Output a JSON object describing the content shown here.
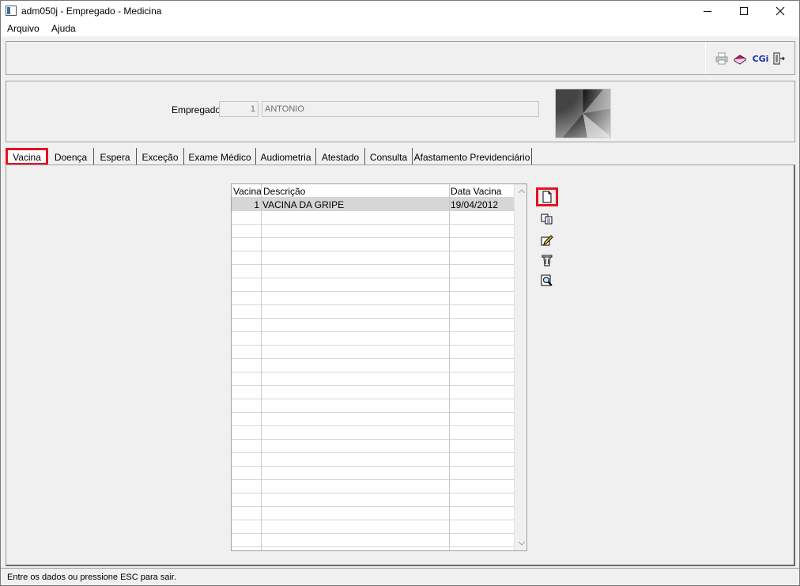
{
  "window": {
    "title": "adm050j - Empregado - Medicina",
    "minimize_glyph": "—",
    "maximize_glyph": "☐",
    "close_glyph": "✕"
  },
  "menu": {
    "items": [
      "Arquivo",
      "Ajuda"
    ]
  },
  "toolbar": {
    "icons": [
      "printer-icon",
      "book-icon",
      "cgi-icon",
      "exit-door-icon"
    ],
    "cgi_label": "CGi"
  },
  "employee": {
    "label": "Empregado:",
    "code": "1",
    "name": "ANTONIO"
  },
  "tabs": [
    {
      "label": "Vacina",
      "active": true
    },
    {
      "label": "Doença",
      "active": false
    },
    {
      "label": "Espera",
      "active": false
    },
    {
      "label": "Exceção",
      "active": false
    },
    {
      "label": "Exame Médico",
      "active": false
    },
    {
      "label": "Audiometria",
      "active": false
    },
    {
      "label": "Atestado",
      "active": false
    },
    {
      "label": "Consulta",
      "active": false
    },
    {
      "label": "Afastamento Previdenciário",
      "active": false
    }
  ],
  "grid": {
    "columns": [
      "Vacina",
      "Descrição",
      "Data Vacina"
    ],
    "rows": [
      {
        "vacina": "1",
        "descricao": "VACINA DA GRIPE",
        "data": "19/04/2012"
      }
    ]
  },
  "actions": [
    "new-document-icon",
    "copy-icon",
    "edit-icon",
    "delete-icon",
    "search-icon"
  ],
  "status": {
    "text": "Entre os dados ou pressione ESC para sair."
  },
  "colors": {
    "highlight": "#e81123",
    "selected_row": "#d6d6d6"
  }
}
